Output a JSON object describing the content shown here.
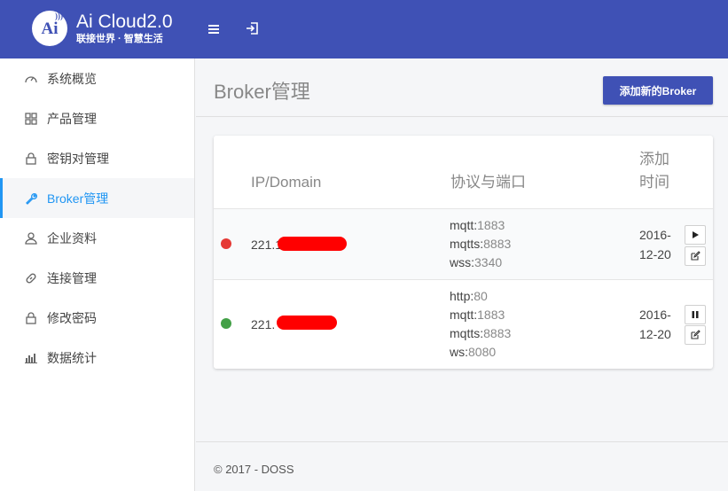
{
  "brand": {
    "logo_text": "Ai",
    "title": "Ai Cloud2.0",
    "subtitle": "联接世界 · 智慧生活"
  },
  "topbar": {
    "menu_icon": "hamburger-menu-icon",
    "logout_icon": "logout-icon"
  },
  "sidebar": {
    "items": [
      {
        "label": "系统概览",
        "icon": "dashboard-icon",
        "active": false
      },
      {
        "label": "产品管理",
        "icon": "grid-icon",
        "active": false
      },
      {
        "label": "密钥对管理",
        "icon": "lock-icon",
        "active": false
      },
      {
        "label": "Broker管理",
        "icon": "wrench-icon",
        "active": true
      },
      {
        "label": "企业资料",
        "icon": "user-icon",
        "active": false
      },
      {
        "label": "连接管理",
        "icon": "link-icon",
        "active": false
      },
      {
        "label": "修改密码",
        "icon": "lock-icon",
        "active": false
      },
      {
        "label": "数据统计",
        "icon": "bar-chart-icon",
        "active": false
      }
    ]
  },
  "page": {
    "title": "Broker管理",
    "add_button": "添加新的Broker"
  },
  "table": {
    "headers": {
      "ip": "IP/Domain",
      "protocol": "协议与端口",
      "time": "添加时间"
    },
    "rows": [
      {
        "status": "red",
        "ip": "221.1",
        "protocols": [
          {
            "name": "mqtt:",
            "port": "1883"
          },
          {
            "name": "mqtts:",
            "port": "8883"
          },
          {
            "name": "wss:",
            "port": "3340"
          }
        ],
        "date": "2016-12-20",
        "toggle_icon": "play-icon",
        "edit_icon": "edit-icon"
      },
      {
        "status": "green",
        "ip": "221.",
        "protocols": [
          {
            "name": "http:",
            "port": "80"
          },
          {
            "name": "mqtt:",
            "port": "1883"
          },
          {
            "name": "mqtts:",
            "port": "8883"
          },
          {
            "name": "ws:",
            "port": "8080"
          }
        ],
        "date": "2016-12-20",
        "toggle_icon": "pause-icon",
        "edit_icon": "edit-icon"
      }
    ]
  },
  "footer": {
    "text": "© 2017 - DOSS"
  },
  "colors": {
    "primary": "#3f51b5",
    "active": "#2196f3",
    "status_red": "#e53935",
    "status_green": "#43a047",
    "redaction": "#ff0000"
  }
}
